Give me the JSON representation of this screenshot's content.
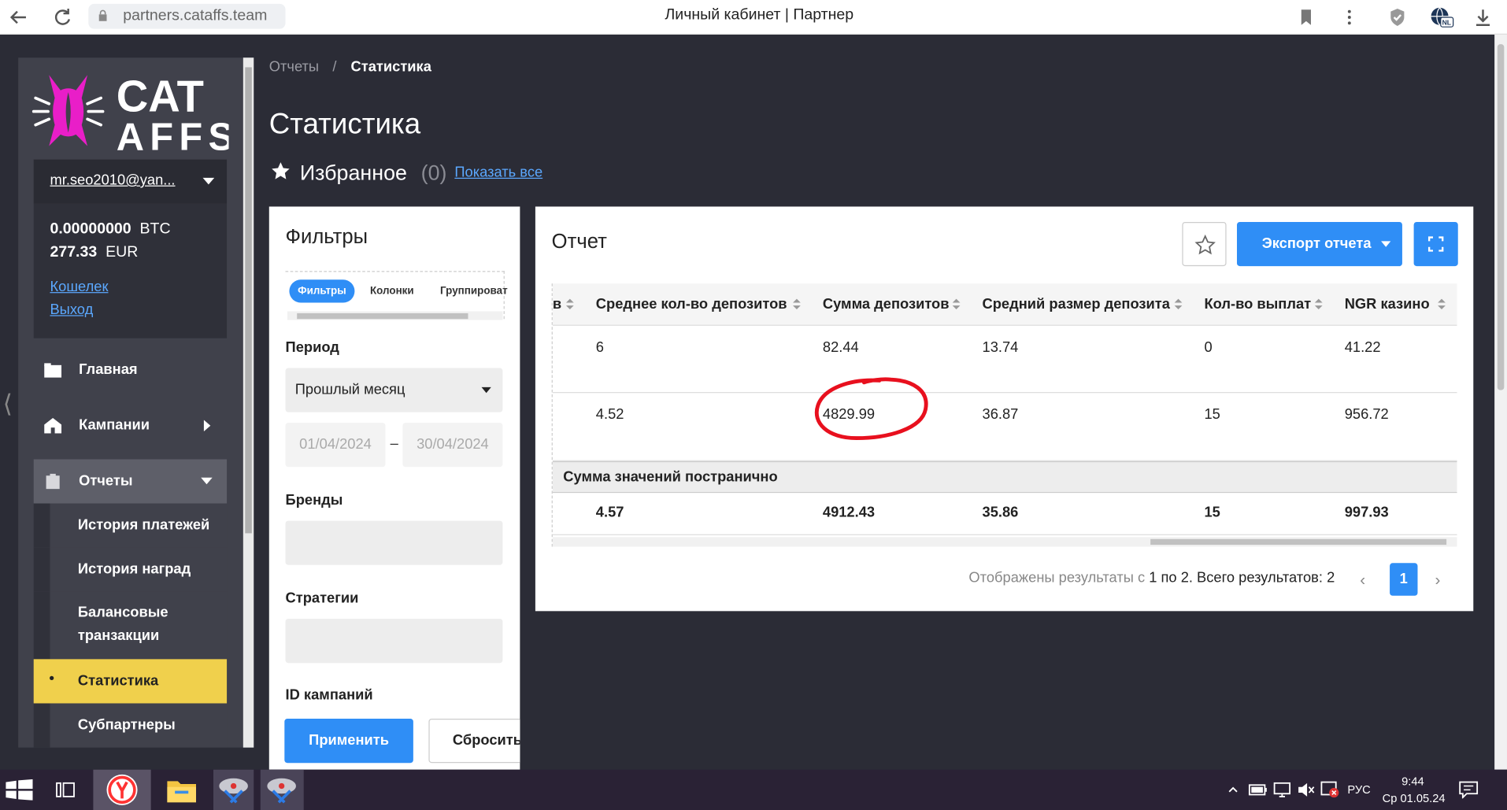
{
  "browser": {
    "url": "partners.cataffs.team",
    "tab_title": "Личный кабинет | Партнер"
  },
  "sidebar": {
    "logo_line1": "CAT",
    "logo_line2": "AFFS",
    "user_email": "mr.seo2010@yan...",
    "balance_btc_value": "0.00000000",
    "balance_btc_currency": "BTC",
    "balance_eur_value": "277.33",
    "balance_eur_currency": "EUR",
    "wallet_link": "Кошелек",
    "logout_link": "Выход",
    "nav": {
      "home": "Главная",
      "campaigns": "Кампании",
      "reports": "Отчеты"
    },
    "sub": {
      "payments": "История платежей",
      "rewards": "История наград",
      "balance_line1": "Балансовые",
      "balance_line2": "транзакции",
      "stats": "Статистика",
      "subpartners": "Субпартнеры"
    },
    "active_bullet": "•"
  },
  "breadcrumb": {
    "parent": "Отчеты",
    "separator": "/",
    "current": "Статистика"
  },
  "page": {
    "title": "Статистика",
    "favorites_label": "Избранное",
    "favorites_count": "(0)",
    "show_all": "Показать все"
  },
  "filters": {
    "title": "Фильтры",
    "tabs": [
      "Фильтры",
      "Колонки",
      "Группироват"
    ],
    "period_label": "Период",
    "period_value": "Прошлый месяц",
    "date_from": "01/04/2024",
    "date_sep": "–",
    "date_to": "30/04/2024",
    "brands_label": "Бренды",
    "strategies_label": "Стратегии",
    "campaign_id_label": "ID кампаний",
    "apply": "Применить",
    "reset": "Сбросить"
  },
  "report": {
    "title": "Отчет",
    "export": "Экспорт отчета",
    "columns": {
      "partial": "в",
      "avg_deposits": "Среднее кол-во депозитов",
      "sum_deposits": "Сумма депозитов",
      "avg_deposit_size": "Средний размер депозита",
      "payouts": "Кол-во выплат",
      "ngr": "NGR казино"
    },
    "rows": [
      {
        "avg_deposits": "6",
        "sum_deposits": "82.44",
        "avg_deposit_size": "13.74",
        "payouts": "0",
        "ngr": "41.22"
      },
      {
        "avg_deposits": "4.52",
        "sum_deposits": "4829.99",
        "avg_deposit_size": "36.87",
        "payouts": "15",
        "ngr": "956.72"
      }
    ],
    "totals_label": "Сумма значений постранично",
    "totals": {
      "avg_deposits": "4.57",
      "sum_deposits": "4912.43",
      "avg_deposit_size": "35.86",
      "payouts": "15",
      "ngr": "997.93"
    },
    "pagination_text_a": "Отображены результаты с ",
    "pagination_from": "1",
    "pagination_text_b": " по ",
    "pagination_to": "2",
    "pagination_text_c": ". Всего результатов: 2",
    "page_prev": "‹",
    "page_current": "1",
    "page_next": "›"
  },
  "taskbar": {
    "lang": "РУС",
    "time": "9:44",
    "date": "Ср 01.05.24"
  },
  "colors": {
    "accent": "#2f8ef6",
    "active_nav": "#f0d04c",
    "sidebar": "#40414b",
    "background": "#2b2c36",
    "annotation": "#e8101e"
  }
}
